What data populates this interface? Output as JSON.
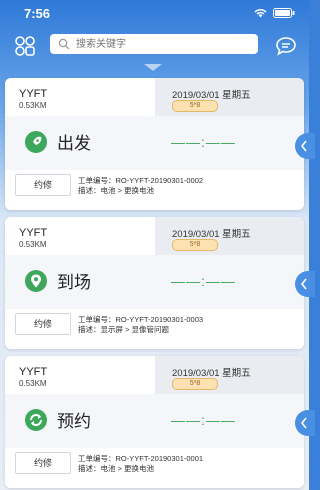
{
  "status_bar": {
    "time": "7:56"
  },
  "search": {
    "placeholder": "搜索关键字"
  },
  "cards": [
    {
      "name": "YYFT",
      "distance": "0.53KM",
      "date": "2019/03/01 星期五",
      "badge": "5*8",
      "status": "出发",
      "time_placeholder": "——:——",
      "button": "约修",
      "order": "工单编号：RO-YYFT-20190301-0002",
      "desc": "描述：电池 > 更换电池",
      "icon": "rocket-icon"
    },
    {
      "name": "YYFT",
      "distance": "0.53KM",
      "date": "2019/03/01 星期五",
      "badge": "5*8",
      "status": "到场",
      "time_placeholder": "——:——",
      "button": "约修",
      "order": "工单编号：RO-YYFT-20190301-0003",
      "desc": "描述：显示屏 > 显像管问题",
      "icon": "location-pin-icon"
    },
    {
      "name": "YYFT",
      "distance": "0.53KM",
      "date": "2019/03/01 星期五",
      "badge": "5*8",
      "status": "预约",
      "time_placeholder": "——:——",
      "button": "约修",
      "order": "工单编号：RO-YYFT-20190301-0001",
      "desc": "描述：电池 > 更换电池",
      "icon": "refresh-icon"
    }
  ],
  "colors": {
    "accent": "#4a90e2",
    "green": "#3da85c",
    "badge_bg": "#fbe2b0"
  }
}
